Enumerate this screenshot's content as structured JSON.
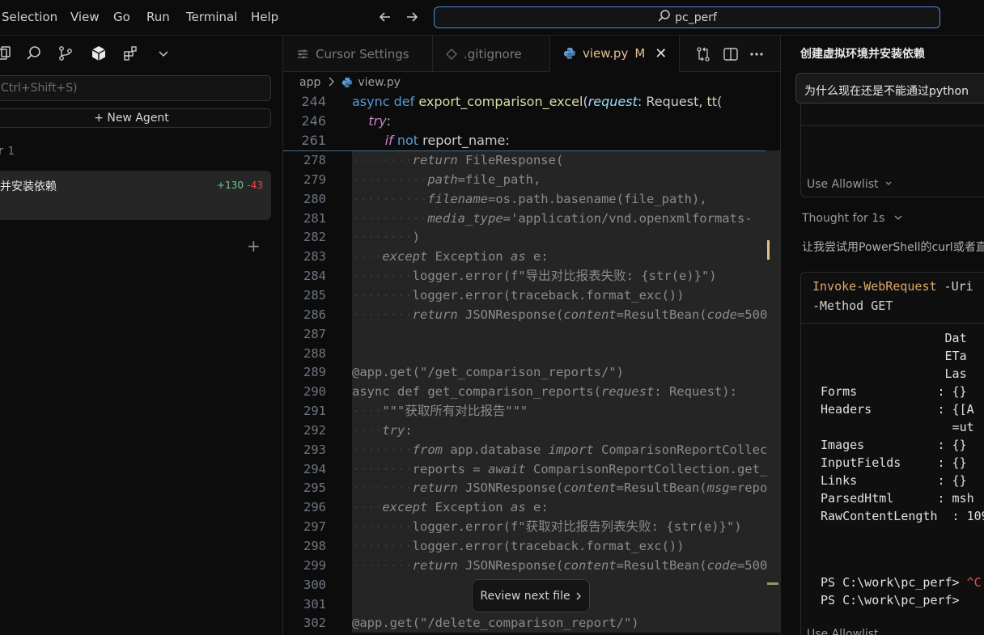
{
  "menu": [
    "Selection",
    "View",
    "Go",
    "Run",
    "Terminal",
    "Help"
  ],
  "search": {
    "text": "pc_perf"
  },
  "left_panel": {
    "search_placeholder": "Ctrl+Shift+S)",
    "new_agent": "+ New Agent",
    "section_label": "r",
    "section_count": "1",
    "item_title": "并安装依赖",
    "item_added": "+130",
    "item_removed": "-43",
    "add_symbol": "+"
  },
  "tabs": [
    {
      "label": "Cursor Settings",
      "icon": "settings-icon"
    },
    {
      "label": ".gitignore",
      "icon": "git-icon"
    },
    {
      "label": "view.py",
      "icon": "python-icon",
      "modified": "M",
      "close": "✕"
    }
  ],
  "breadcrumb": {
    "folder": "app",
    "file": "view.py"
  },
  "sticky_lines": [
    {
      "n": "244",
      "parts": [
        [
          "kw",
          "async "
        ],
        [
          "kw",
          "def "
        ],
        [
          "fn",
          "export_comparison_excel"
        ],
        [
          "",
          "("
        ],
        [
          "prm",
          "request"
        ],
        [
          "",
          ": Request, "
        ],
        [
          "fn",
          "t"
        ],
        [
          "",
          "t("
        ]
      ]
    },
    {
      "n": "246",
      "parts": [
        [
          "",
          "    "
        ],
        [
          "ctl",
          "try"
        ],
        [
          "",
          ":"
        ]
      ]
    },
    {
      "n": "261",
      "parts": [
        [
          "",
          "        "
        ],
        [
          "ctl",
          "if "
        ],
        [
          "kw",
          "not "
        ],
        [
          "",
          "report_name:"
        ]
      ]
    }
  ],
  "code_lines": [
    {
      "n": "278",
      "diff": true,
      "parts": [
        [
          "ws",
          "········"
        ],
        [
          "dimit",
          "return "
        ],
        [
          "dim",
          "FileResponse("
        ]
      ]
    },
    {
      "n": "279",
      "diff": true,
      "parts": [
        [
          "ws",
          "··········"
        ],
        [
          "dimit",
          "path"
        ],
        [
          "dim",
          "=file_path,"
        ]
      ]
    },
    {
      "n": "280",
      "diff": true,
      "parts": [
        [
          "ws",
          "··········"
        ],
        [
          "dimit",
          "filename"
        ],
        [
          "dim",
          "=os.path.basename(file_path),"
        ]
      ]
    },
    {
      "n": "281",
      "diff": true,
      "parts": [
        [
          "ws",
          "··········"
        ],
        [
          "dimit",
          "media_type"
        ],
        [
          "dim",
          "='application/vnd.openxmlformats-"
        ]
      ]
    },
    {
      "n": "282",
      "diff": true,
      "parts": [
        [
          "ws",
          "········"
        ],
        [
          "dim",
          ")"
        ]
      ]
    },
    {
      "n": "283",
      "diff": true,
      "parts": [
        [
          "ws",
          "····"
        ],
        [
          "dimit",
          "except "
        ],
        [
          "dim",
          "Exception "
        ],
        [
          "dimit",
          "as "
        ],
        [
          "dim",
          "e:"
        ]
      ]
    },
    {
      "n": "284",
      "diff": true,
      "parts": [
        [
          "ws",
          "········"
        ],
        [
          "dim",
          "logger.error(f\"导出对比报表失败: {str(e)}\")"
        ]
      ]
    },
    {
      "n": "285",
      "diff": true,
      "parts": [
        [
          "ws",
          "········"
        ],
        [
          "dim",
          "logger.error(traceback.format_exc())"
        ]
      ]
    },
    {
      "n": "286",
      "diff": true,
      "parts": [
        [
          "ws",
          "········"
        ],
        [
          "dimit",
          "return "
        ],
        [
          "dim",
          "JSONResponse("
        ],
        [
          "dimit",
          "content"
        ],
        [
          "dim",
          "=ResultBean("
        ],
        [
          "dimit",
          "code"
        ],
        [
          "dim",
          "=500"
        ]
      ]
    },
    {
      "n": "287",
      "diff": true,
      "parts": []
    },
    {
      "n": "288",
      "diff": true,
      "parts": []
    },
    {
      "n": "289",
      "diff": true,
      "parts": [
        [
          "dim",
          "@app.get(\"/get_comparison_reports/\")"
        ]
      ]
    },
    {
      "n": "290",
      "diff": true,
      "parts": [
        [
          "dim",
          "async def get_comparison_reports("
        ],
        [
          "dimit",
          "request"
        ],
        [
          "dim",
          ": Request):"
        ]
      ]
    },
    {
      "n": "291",
      "diff": true,
      "parts": [
        [
          "ws",
          "····"
        ],
        [
          "dim",
          "\"\"\"获取所有对比报告\"\"\""
        ]
      ]
    },
    {
      "n": "292",
      "diff": true,
      "parts": [
        [
          "ws",
          "····"
        ],
        [
          "dimit",
          "try"
        ],
        [
          "dim",
          ":"
        ]
      ]
    },
    {
      "n": "293",
      "diff": true,
      "parts": [
        [
          "ws",
          "········"
        ],
        [
          "dimit",
          "from "
        ],
        [
          "dim",
          "app.database "
        ],
        [
          "dimit",
          "import "
        ],
        [
          "dim",
          "ComparisonReportCollec"
        ]
      ]
    },
    {
      "n": "294",
      "diff": true,
      "parts": [
        [
          "ws",
          "········"
        ],
        [
          "dim",
          "reports = "
        ],
        [
          "dimit",
          "await "
        ],
        [
          "dim",
          "ComparisonReportCollection.get_"
        ]
      ]
    },
    {
      "n": "295",
      "diff": true,
      "parts": [
        [
          "ws",
          "········"
        ],
        [
          "dimit",
          "return "
        ],
        [
          "dim",
          "JSONResponse("
        ],
        [
          "dimit",
          "content"
        ],
        [
          "dim",
          "=ResultBean("
        ],
        [
          "dimit",
          "msg"
        ],
        [
          "dim",
          "=repo"
        ]
      ]
    },
    {
      "n": "296",
      "diff": true,
      "parts": [
        [
          "ws",
          "····"
        ],
        [
          "dimit",
          "except "
        ],
        [
          "dim",
          "Exception "
        ],
        [
          "dimit",
          "as "
        ],
        [
          "dim",
          "e:"
        ]
      ]
    },
    {
      "n": "297",
      "diff": true,
      "parts": [
        [
          "ws",
          "········"
        ],
        [
          "dim",
          "logger.error(f\"获取对比报告列表失败: {str(e)}\")"
        ]
      ]
    },
    {
      "n": "298",
      "diff": true,
      "parts": [
        [
          "ws",
          "········"
        ],
        [
          "dim",
          "logger.error(traceback.format_exc())"
        ]
      ]
    },
    {
      "n": "299",
      "diff": true,
      "parts": [
        [
          "ws",
          "········"
        ],
        [
          "dimit",
          "return "
        ],
        [
          "dim",
          "JSONResponse("
        ],
        [
          "dimit",
          "content"
        ],
        [
          "dim",
          "=ResultBean("
        ],
        [
          "dimit",
          "code"
        ],
        [
          "dim",
          "=500"
        ]
      ]
    },
    {
      "n": "300",
      "diff": true,
      "parts": []
    },
    {
      "n": "301",
      "diff": true,
      "parts": []
    },
    {
      "n": "302",
      "diff": true,
      "parts": [
        [
          "dim",
          "@app.get(\"/delete_comparison_report/\")"
        ]
      ]
    }
  ],
  "review_button": "Review next file",
  "right_panel": {
    "title": "创建虚拟环境并安装依赖",
    "question": "为什么现在还是不能通过python",
    "allowlist_label": "Use Allowlist",
    "thought": "Thought for 1s",
    "assistant_text": "让我尝试用PowerShell的curl或者直",
    "command_name": "Invoke-WebRequest",
    "command_rest": " -Uri",
    "command_line2": "-Method GET",
    "terminal_lines": [
      "                 Dat",
      "                 ETa",
      "                 Las",
      "Forms           : {}",
      "Headers         : {[A",
      "                  =ut",
      "Images          : {}",
      "InputFields     : {}",
      "Links           : {}",
      "ParsedHtml      : msh",
      "RawContentLength  : 109"
    ],
    "prompt1": "PS C:\\work\\pc_perf> ",
    "ctrl_c": "^C",
    "prompt2": "PS C:\\work\\pc_perf>"
  }
}
